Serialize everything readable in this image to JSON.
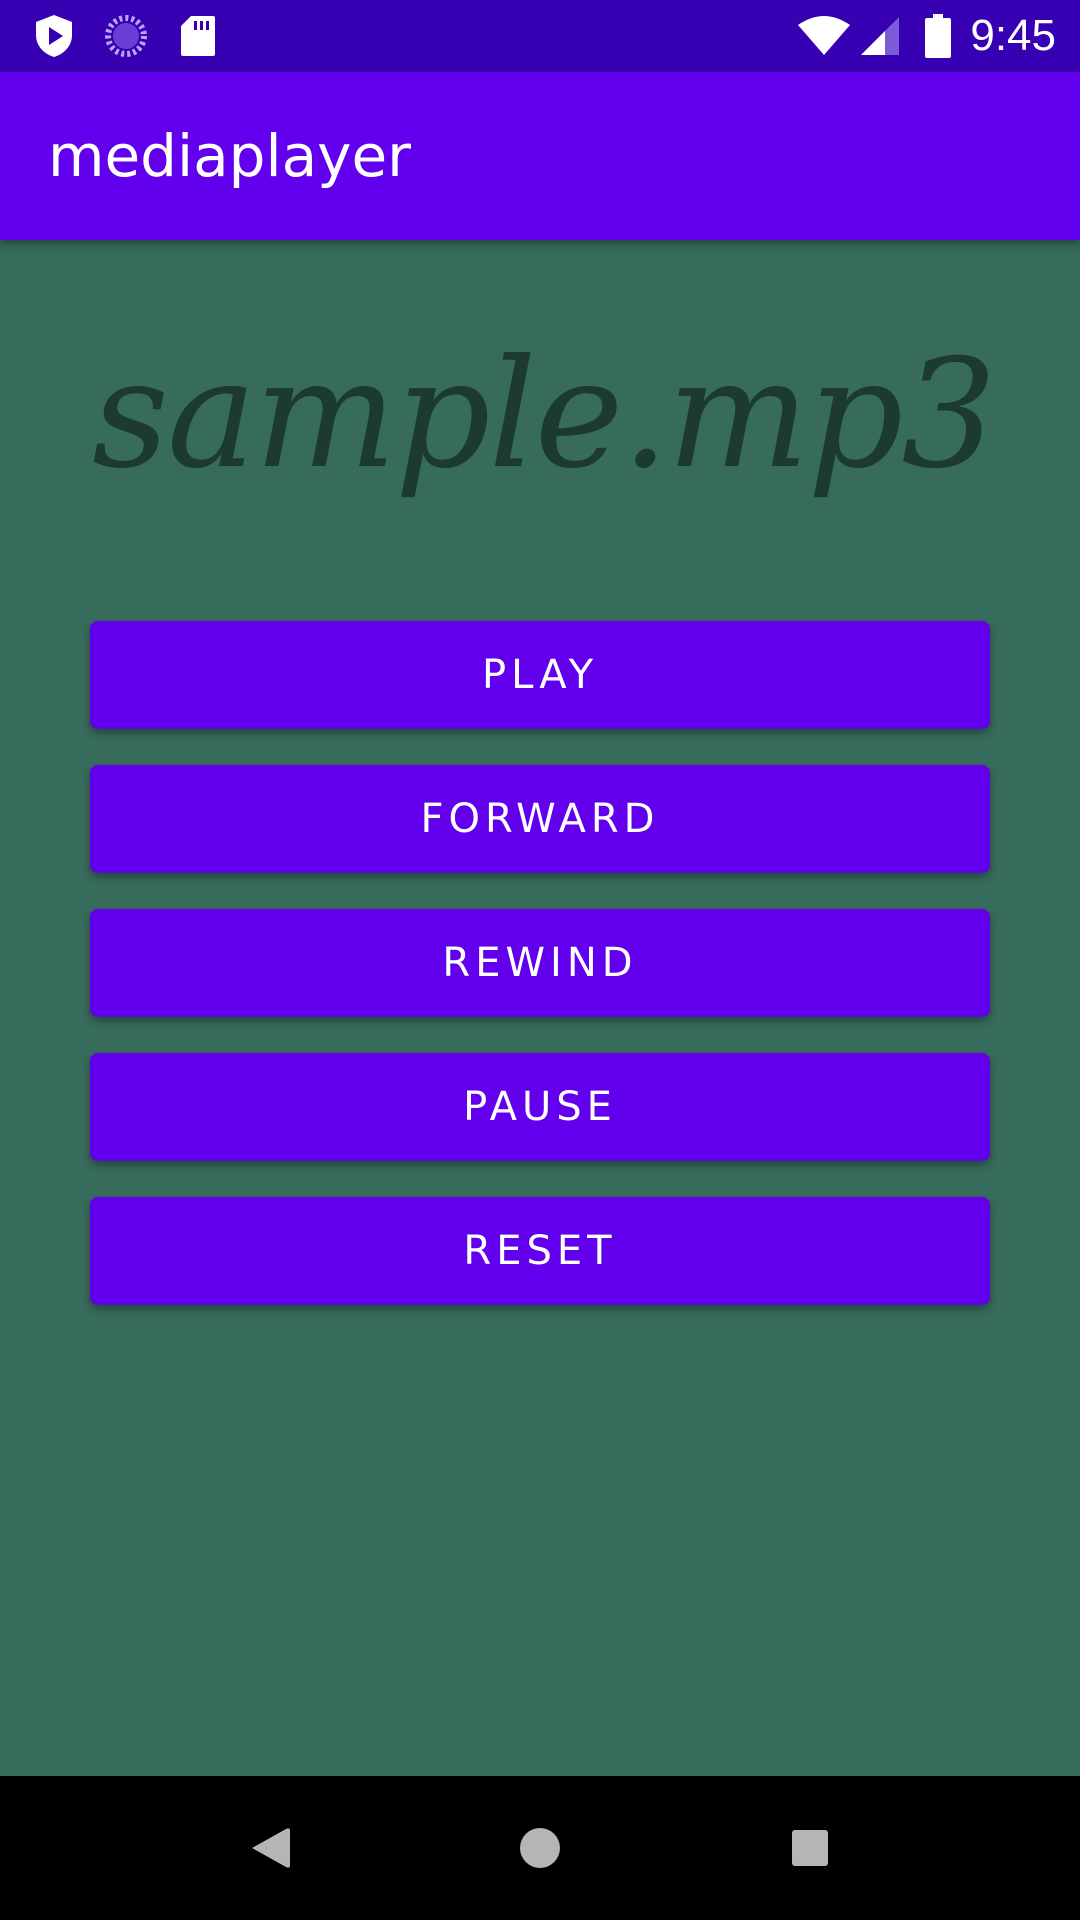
{
  "status_bar": {
    "time": "9:45",
    "icons": [
      "shield-play-icon",
      "loading-spinner-icon",
      "sd-card-icon",
      "wifi-icon",
      "signal-icon",
      "battery-icon"
    ]
  },
  "app_bar": {
    "title": "mediaplayer"
  },
  "main": {
    "song_title": "sample.mp3",
    "buttons": [
      {
        "label": "PLAY"
      },
      {
        "label": "FORWARD"
      },
      {
        "label": "REWIND"
      },
      {
        "label": "PAUSE"
      },
      {
        "label": "RESET"
      }
    ]
  },
  "nav_bar": {
    "icons": [
      "back-icon",
      "home-icon",
      "recents-icon"
    ]
  },
  "colors": {
    "status_bar": "#3700b3",
    "primary": "#6200ee",
    "background": "#376b5c",
    "song_title": "#1c3a31",
    "nav_bar": "#000000"
  }
}
